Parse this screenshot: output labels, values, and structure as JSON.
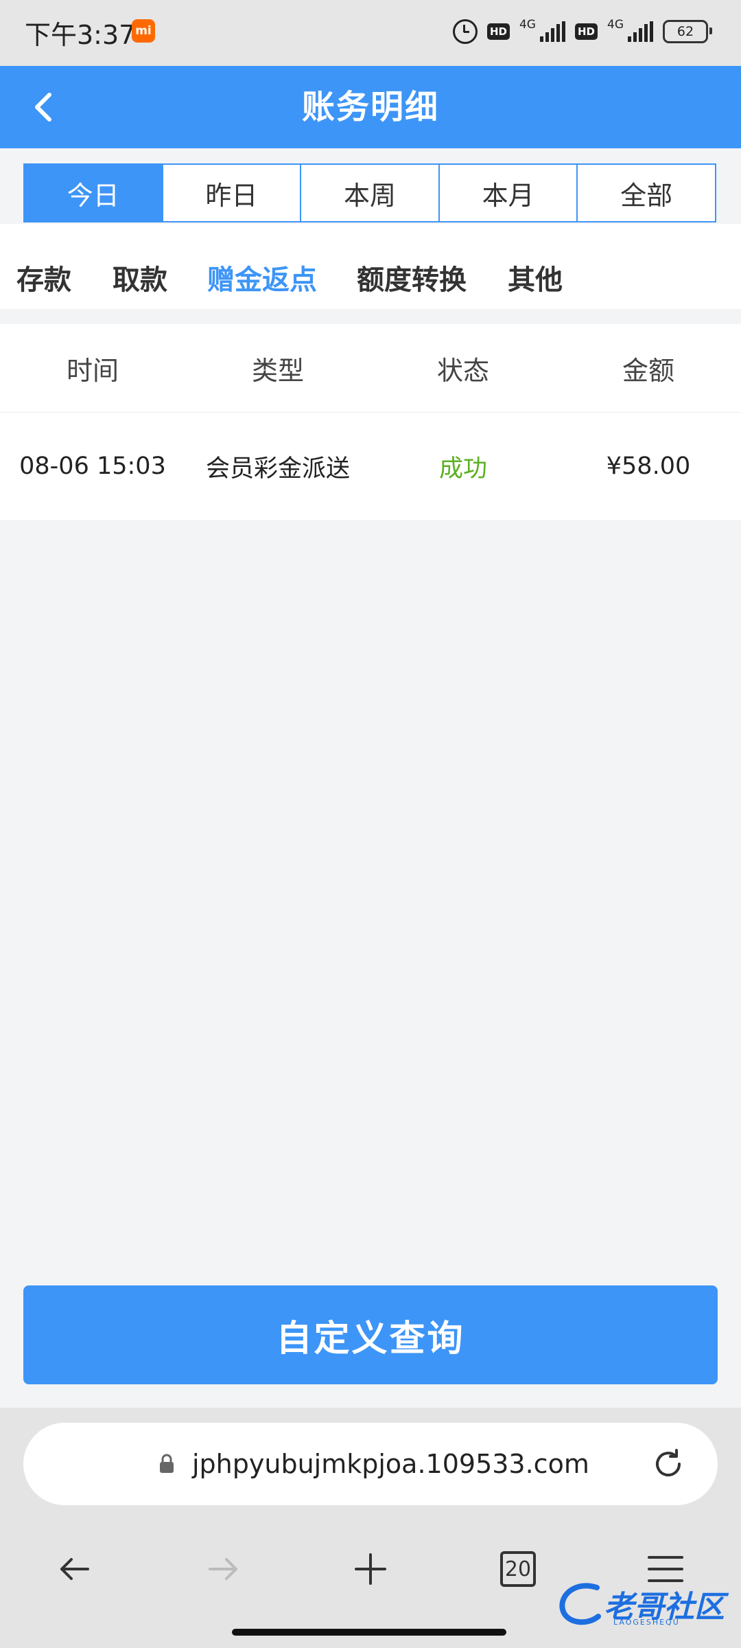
{
  "status_bar": {
    "time": "下午3:37",
    "badge": "mi",
    "hd1": "HD",
    "net1": "4G",
    "hd2": "HD",
    "net2": "4G",
    "battery": "62"
  },
  "header": {
    "title": "账务明细"
  },
  "date_tabs": [
    {
      "label": "今日",
      "active": true
    },
    {
      "label": "昨日",
      "active": false
    },
    {
      "label": "本周",
      "active": false
    },
    {
      "label": "本月",
      "active": false
    },
    {
      "label": "全部",
      "active": false
    }
  ],
  "categories": [
    {
      "label": "存款",
      "active": false
    },
    {
      "label": "取款",
      "active": false
    },
    {
      "label": "赠金返点",
      "active": true
    },
    {
      "label": "额度转换",
      "active": false
    },
    {
      "label": "其他",
      "active": false
    }
  ],
  "table": {
    "headers": [
      "时间",
      "类型",
      "状态",
      "金额"
    ],
    "rows": [
      {
        "time": "08-06 15:03",
        "type": "会员彩金派送",
        "status": "成功",
        "amount": "¥58.00"
      }
    ]
  },
  "query_button": "自定义查询",
  "browser": {
    "url": "jphpyubujmkpjoa.109533.com",
    "tab_count": "20"
  },
  "watermark": {
    "text": "老哥社区",
    "sub": "LAOGESHEQU"
  },
  "colors": {
    "accent": "#3d95f7",
    "success": "#5cb021",
    "background": "#f3f4f6"
  }
}
